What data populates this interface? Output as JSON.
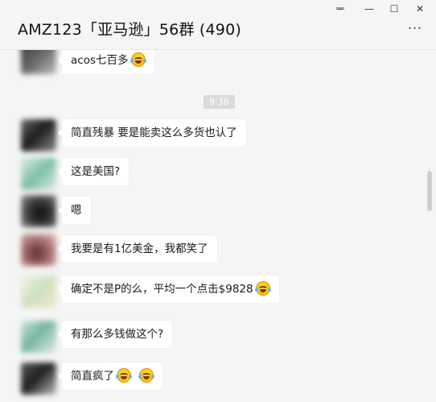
{
  "window": {
    "title": "AMZ123「亚马逊」56群 (490)",
    "controls": {
      "pin": "ᆓ",
      "minimize": "—",
      "maximize": "☐",
      "close": "✕"
    },
    "more": "…"
  },
  "chat": {
    "timestamp": "9:38",
    "messages": [
      {
        "text": "acos七百多",
        "emoji": [
          "laugh-cry"
        ]
      },
      {
        "text": "简直残暴 要是能卖这么多货也认了",
        "emoji": []
      },
      {
        "text": "这是美国?",
        "emoji": []
      },
      {
        "text": "嗯",
        "emoji": []
      },
      {
        "text": "我要是有1亿美金，我都笑了",
        "emoji": []
      },
      {
        "text": "确定不是P的么，平均一个点击$9828",
        "emoji": [
          "laugh-cry"
        ]
      },
      {
        "text": "有那么多钱做这个?",
        "emoji": []
      },
      {
        "text": "简直疯了",
        "emoji": [
          "laugh-cry",
          "laugh-cry"
        ]
      }
    ]
  },
  "colors": {
    "background": "#f5f5f5",
    "bubble": "#ffffff",
    "timestamp_pill": "#dadada"
  }
}
